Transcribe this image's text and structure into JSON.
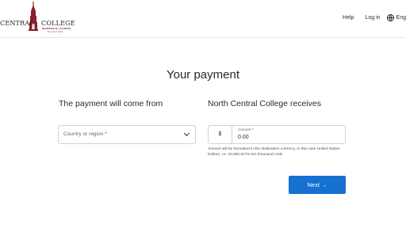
{
  "header": {
    "logo": {
      "left_text": "CENTRAL",
      "right_text": "COLLEGE",
      "subtitle": "NAPERVILLE, ILLINOIS",
      "founded": "Founded 1861",
      "brand_color": "#8a1f2d"
    },
    "nav": {
      "help": "Help",
      "login": "Log in",
      "language": "Eng"
    }
  },
  "main": {
    "title": "Your payment",
    "left_column": {
      "heading": "The payment will come from",
      "country_placeholder": "Country or region *"
    },
    "right_column": {
      "heading": "North Central College receives",
      "currency_symbol": "$",
      "amount_label": "Amount *",
      "amount_value": "0.00",
      "hint": "Amount will be formatted in the destination currency, in this case United States Dollars, i.e. 10,000.00 for ten thousand USD."
    },
    "next_button": "Next →"
  },
  "colors": {
    "accent": "#1670d2",
    "border": "#cdd3d9"
  }
}
